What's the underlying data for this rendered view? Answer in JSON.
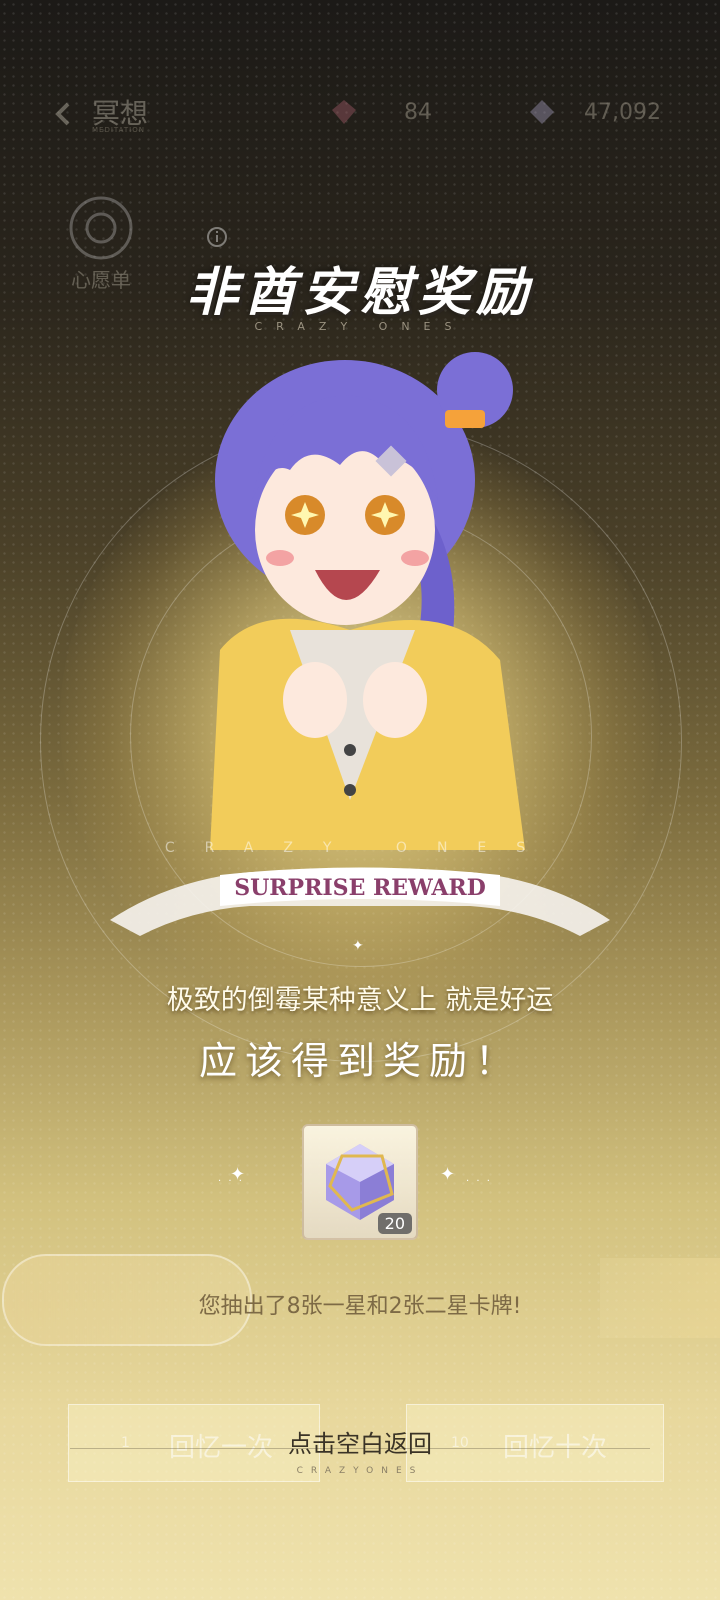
{
  "top_bar": {
    "title": "冥想",
    "subtitle": "MEDITATION",
    "gem_count": "84",
    "crystal_count": "47,092",
    "wish_label": "心愿单"
  },
  "popup": {
    "title": "非酋安慰奖励",
    "title_sub": "CRAZY ONES",
    "banner_crazy": "CRAZY ONES",
    "banner_text": "SURPRISE REWARD",
    "line1": "极致的倒霉某种意义上 就是好运",
    "line2": "应该得到奖励！",
    "reward_quantity": "20",
    "result_text": "您抽出了8张一星和2张二星卡牌!",
    "return_text": "点击空白返回",
    "return_sub": "CRAZYONES"
  },
  "buttons": {
    "once_label": "回忆一次",
    "once_cost": "1",
    "ten_label": "回忆十次",
    "ten_cost": "10"
  },
  "colors": {
    "ribbon_text": "#8a3f6b",
    "result_text": "#7d6a46",
    "hair": "#7b6fd6",
    "jacket": "#f2cc5a"
  }
}
